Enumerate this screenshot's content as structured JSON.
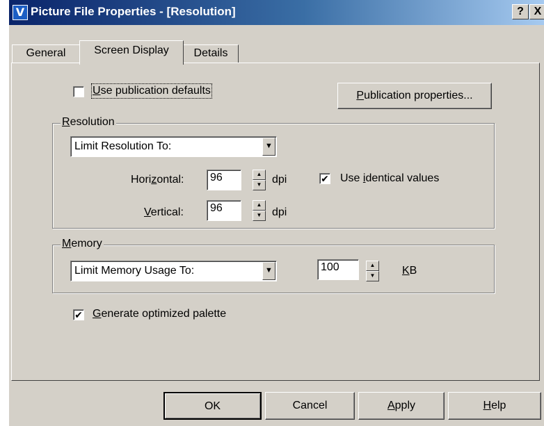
{
  "window": {
    "title": "Picture File Properties - [Resolution]",
    "app_icon_letter": "V",
    "help_glyph": "?",
    "close_glyph": "X"
  },
  "tabs": [
    {
      "label": "General",
      "selected": false
    },
    {
      "label": "Screen Display",
      "selected": true
    },
    {
      "label": "Details",
      "selected": false
    }
  ],
  "options": {
    "use_defaults": {
      "pre": "",
      "key": "U",
      "post": "se publication defaults",
      "checked": false
    },
    "publication_properties": {
      "pre": "",
      "key": "P",
      "post": "ublication properties..."
    },
    "generate_palette": {
      "pre": "",
      "key": "G",
      "post": "enerate optimized palette",
      "checked": true
    }
  },
  "resolution": {
    "group_title": {
      "pre": "",
      "key": "R",
      "post": "esolution"
    },
    "mode": "Limit Resolution To:",
    "horizontal_label": {
      "pre": "Hori",
      "key": "z",
      "post": "ontal:"
    },
    "horizontal_value": "96",
    "vertical_label": {
      "pre": "",
      "key": "V",
      "post": "ertical:"
    },
    "vertical_value": "96",
    "unit": "dpi",
    "identical": {
      "pre": "Use ",
      "key": "i",
      "post": "dentical values",
      "checked": true
    }
  },
  "memory": {
    "group_title": {
      "pre": "",
      "key": "M",
      "post": "emory"
    },
    "mode": "Limit Memory Usage To:",
    "value": "100",
    "unit": {
      "pre": "",
      "key": "K",
      "post": "B"
    }
  },
  "footer": {
    "ok": "OK",
    "cancel": "Cancel",
    "apply": {
      "pre": "",
      "key": "A",
      "post": "pply"
    },
    "help": {
      "pre": "",
      "key": "H",
      "post": "elp"
    }
  },
  "icons": {
    "check": "✔",
    "arrow_down": "▼",
    "arrow_up": "▲"
  },
  "colors": {
    "title_start": "#0a246a",
    "title_end": "#a6caf0",
    "face": "#d4d0c8"
  }
}
